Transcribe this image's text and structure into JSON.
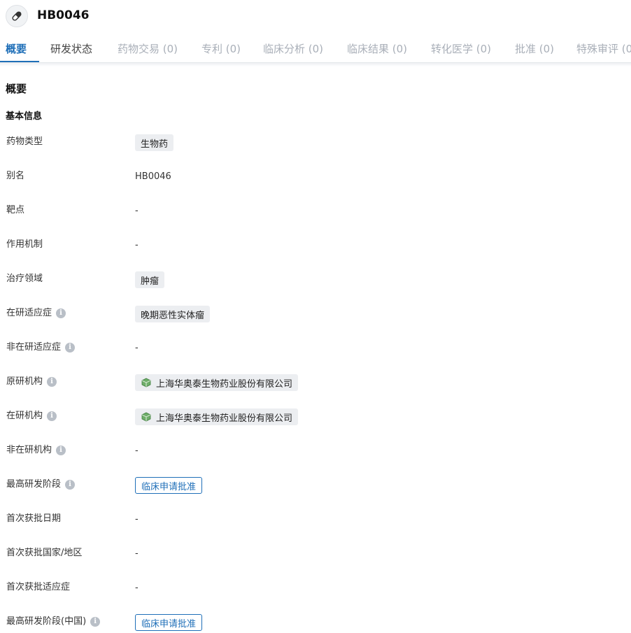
{
  "header": {
    "title": "HB0046",
    "icon": "pill-icon"
  },
  "tabs": [
    {
      "label": "概要",
      "state": "active"
    },
    {
      "label": "研发状态",
      "state": "normal"
    },
    {
      "label": "药物交易 (0)",
      "state": "disabled"
    },
    {
      "label": "专利 (0)",
      "state": "disabled"
    },
    {
      "label": "临床分析 (0)",
      "state": "disabled"
    },
    {
      "label": "临床结果 (0)",
      "state": "disabled"
    },
    {
      "label": "转化医学 (0)",
      "state": "disabled"
    },
    {
      "label": "批准 (0)",
      "state": "disabled"
    },
    {
      "label": "特殊审评 (0",
      "state": "disabled"
    }
  ],
  "section": {
    "title": "概要",
    "subtitle": "基本信息"
  },
  "fields": [
    {
      "label": "药物类型",
      "info": false,
      "type": "tag",
      "value": "生物药"
    },
    {
      "label": "别名",
      "info": false,
      "type": "text",
      "value": "HB0046"
    },
    {
      "label": "靶点",
      "info": false,
      "type": "text",
      "value": "-"
    },
    {
      "label": "作用机制",
      "info": false,
      "type": "text",
      "value": "-"
    },
    {
      "label": "治疗领域",
      "info": false,
      "type": "tag",
      "value": "肿瘤"
    },
    {
      "label": "在研适应症",
      "info": true,
      "type": "tag",
      "value": "晚期恶性实体瘤"
    },
    {
      "label": "非在研适应症",
      "info": true,
      "type": "text",
      "value": "-"
    },
    {
      "label": "原研机构",
      "info": true,
      "type": "org",
      "value": "上海华奥泰生物药业股份有限公司"
    },
    {
      "label": "在研机构",
      "info": true,
      "type": "org",
      "value": "上海华奥泰生物药业股份有限公司"
    },
    {
      "label": "非在研机构",
      "info": true,
      "type": "text",
      "value": "-"
    },
    {
      "label": "最高研发阶段",
      "info": true,
      "type": "phase",
      "value": "临床申请批准"
    },
    {
      "label": "首次获批日期",
      "info": false,
      "type": "text",
      "value": "-"
    },
    {
      "label": "首次获批国家/地区",
      "info": false,
      "type": "text",
      "value": "-"
    },
    {
      "label": "首次获批适应症",
      "info": false,
      "type": "text",
      "value": "-"
    },
    {
      "label": "最高研发阶段(中国)",
      "info": true,
      "type": "phase",
      "value": "临床申请批准"
    }
  ],
  "colors": {
    "accent": "#1f6fb8",
    "tag_bg": "#eceef1",
    "muted": "#a9afb8"
  }
}
